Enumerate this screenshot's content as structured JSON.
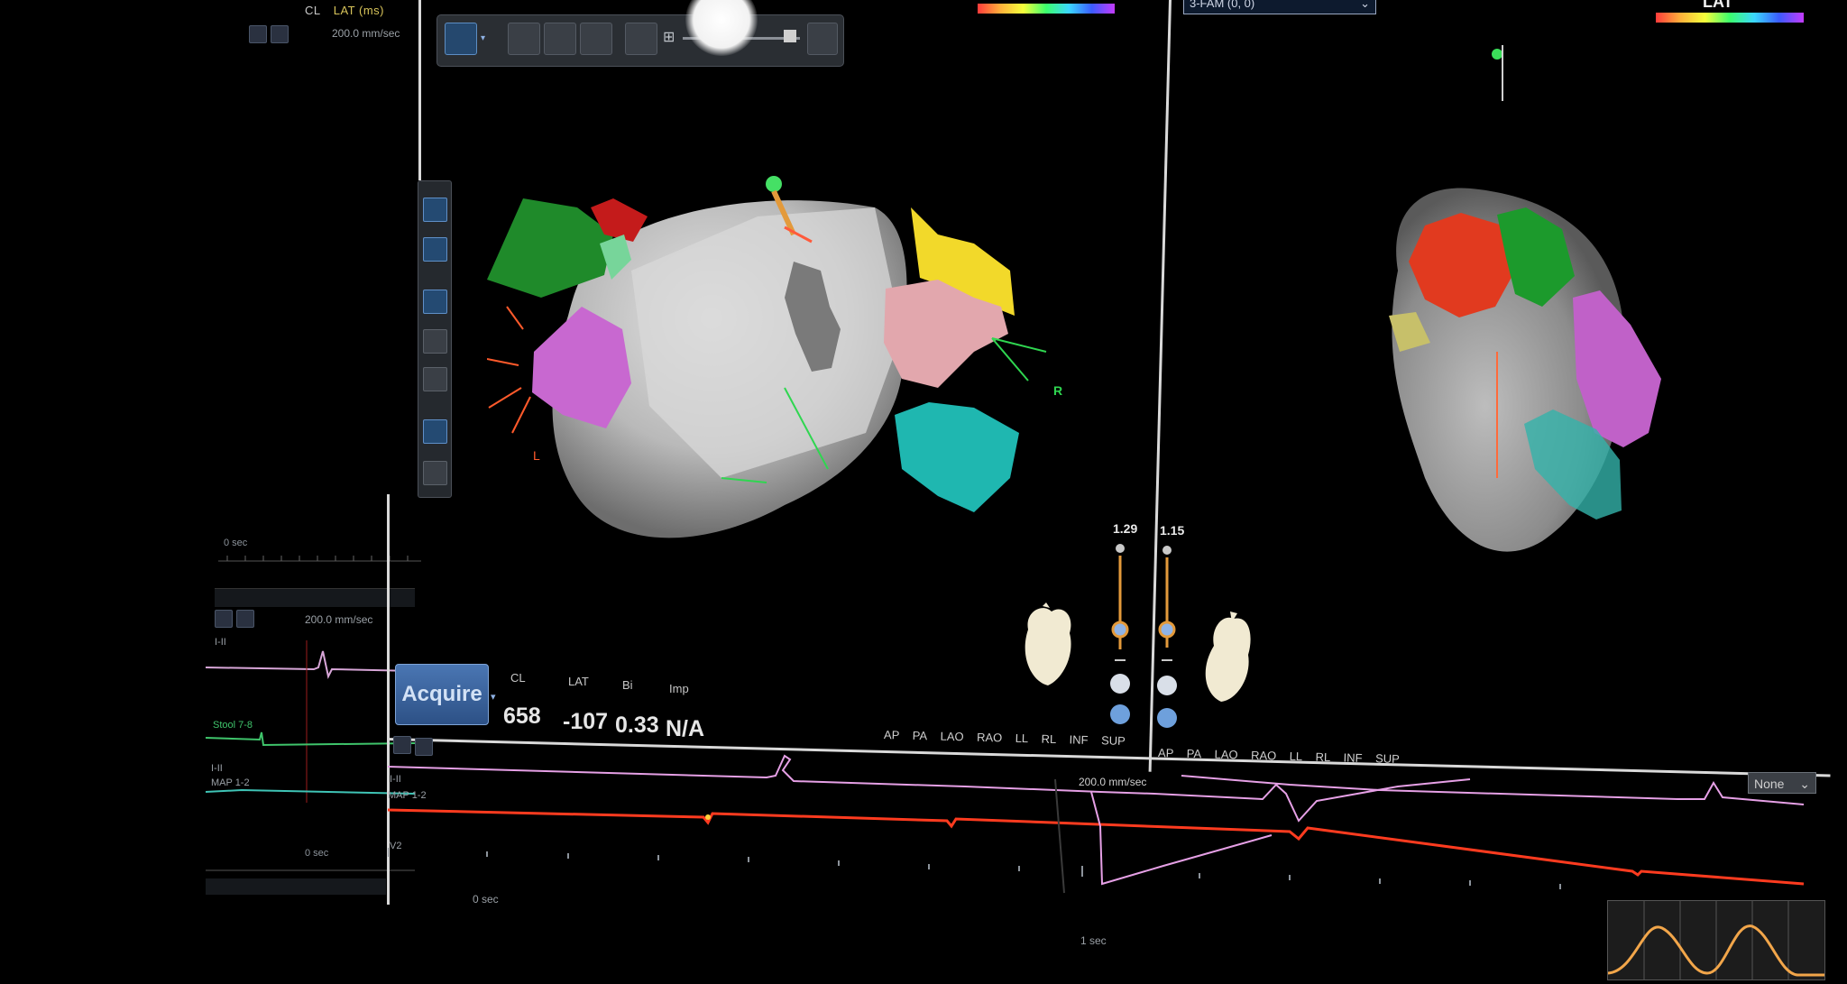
{
  "left_panel": {
    "header_cl": "CL",
    "header_lat": "LAT (ms)",
    "speed_top": "200.0 mm/sec",
    "speed_mid": "200.0 mm/sec",
    "time_top": "0 sec",
    "time_bottom": "0 sec",
    "channels": [
      "I-II",
      "Stool 7-8",
      "I-II",
      "MAP 1-2"
    ]
  },
  "toolbar": {
    "buttons": [
      "select-tool",
      "rotate-tool",
      "pan-tool",
      "zoom-tool",
      "grid-tool"
    ],
    "active": "select-tool"
  },
  "map_left": {
    "label_L": "L",
    "label_R": "R"
  },
  "map_right": {
    "dropdown_value": "3-FAM (0, 0)",
    "colorbar_title": "LAT"
  },
  "acquire": {
    "button_label": "Acquire",
    "labels": [
      "CL",
      "LAT",
      "Bi",
      "Imp"
    ],
    "values": [
      "658",
      "-107",
      "0.33",
      "N/A"
    ]
  },
  "view_controls": {
    "left_scale": "1.29",
    "right_scale": "1.15",
    "left_views": [
      "AP",
      "PA",
      "LAO",
      "RAO",
      "LL",
      "RL",
      "INF",
      "SUP"
    ],
    "right_views": [
      "AP",
      "PA",
      "LAO",
      "RAO",
      "LL",
      "RL",
      "INF",
      "SUP"
    ]
  },
  "strip": {
    "channels": [
      "I-II",
      "MAP 1-2",
      "V2"
    ],
    "speed": "200.0 mm/sec",
    "t0": "0 sec",
    "t1": "1 sec",
    "filter_value": "None"
  },
  "colors": {
    "trace_pink": "#e6a0e6",
    "trace_red": "#ff3b1f",
    "accent_blue": "#3f6fb0"
  }
}
